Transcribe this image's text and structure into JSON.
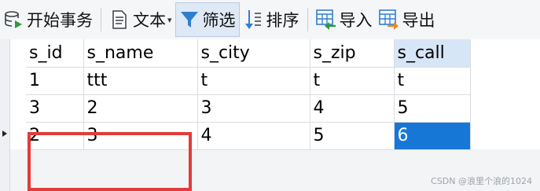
{
  "toolbar": {
    "begin_transaction": "开始事务",
    "text": "文本",
    "filter": "筛选",
    "sort": "排序",
    "import": "导入",
    "export": "导出"
  },
  "grid": {
    "columns": [
      "s_id",
      "s_name",
      "s_city",
      "s_zip",
      "s_call"
    ],
    "rows": [
      [
        "1",
        "ttt",
        "t",
        "t",
        "t"
      ],
      [
        "3",
        "2",
        "3",
        "4",
        "5"
      ],
      [
        "2",
        "3",
        "4",
        "5",
        "6"
      ]
    ],
    "selected_cell": "6"
  },
  "watermark": "CSDN @浪里个浪的1024",
  "colors": {
    "selection": "#1677d6",
    "highlight_box": "#e23b3b",
    "sorted_header": "#d7e6f6"
  }
}
